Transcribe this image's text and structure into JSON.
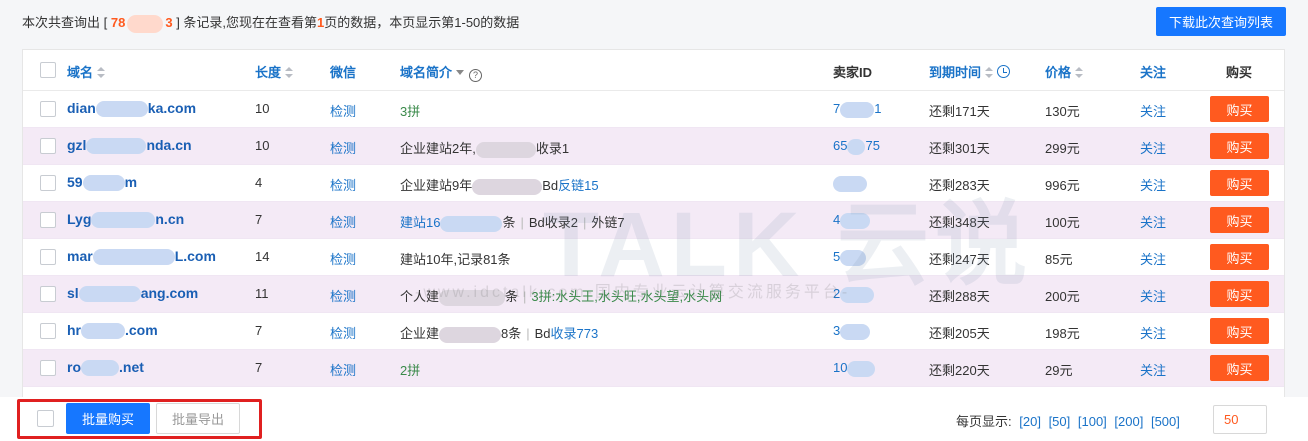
{
  "summary": {
    "prefix": "本次共查询出 [",
    "count": "78",
    "count_tail": "3",
    "middle": "] 条记录,您现在在查看第",
    "page": "1",
    "suffix": "页的数据，本页显示第1-50的数据"
  },
  "download_label": "下载此次查询列表",
  "headers": {
    "domain": "域名",
    "length": "长度",
    "wechat": "微信",
    "intro": "域名简介",
    "seller": "卖家ID",
    "expiry": "到期时间",
    "price": "价格",
    "follow": "关注",
    "buy": "购买"
  },
  "rows": [
    {
      "dom_a": "dian",
      "dom_b": "ka.com",
      "length": "10",
      "check": "检测",
      "intro_a": "3拼",
      "intro_b": "",
      "intro_c": "",
      "seller_a": "7",
      "seller_b": "1",
      "expiry": "还剩171天",
      "price": "130元",
      "follow": "关注",
      "buy": "购买"
    },
    {
      "dom_a": "gzl",
      "dom_b": "nda.cn",
      "length": "10",
      "check": "检测",
      "intro_a": "企业建站2年,",
      "intro_b": "收录1",
      "intro_c": "",
      "seller_a": "65",
      "seller_b": "75",
      "expiry": "还剩301天",
      "price": "299元",
      "follow": "关注",
      "buy": "购买"
    },
    {
      "dom_a": "59",
      "dom_b": "m",
      "length": "4",
      "check": "检测",
      "intro_a": "企业建站9年",
      "intro_b": "Bd",
      "intro_c": "反链15",
      "seller_a": "",
      "seller_b": "",
      "expiry": "还剩283天",
      "price": "996元",
      "follow": "关注",
      "buy": "购买"
    },
    {
      "dom_a": "Lyg",
      "dom_b": "n.cn",
      "length": "7",
      "check": "检测",
      "intro_a": "建站16",
      "intro_b": "条",
      "intro_c": "Bd收录2",
      "intro_d": "外链7",
      "seller_a": "4",
      "seller_b": "",
      "expiry": "还剩348天",
      "price": "100元",
      "follow": "关注",
      "buy": "购买"
    },
    {
      "dom_a": "mar",
      "dom_b": "L.com",
      "length": "14",
      "check": "检测",
      "intro_a": "建站10年,记录81条",
      "intro_b": "",
      "intro_c": "",
      "seller_a": "5",
      "seller_b": "",
      "expiry": "还剩247天",
      "price": "85元",
      "follow": "关注",
      "buy": "购买"
    },
    {
      "dom_a": "sl",
      "dom_b": "ang.com",
      "length": "11",
      "check": "检测",
      "intro_a": "个人建",
      "intro_b": "条",
      "intro_c": "3拼:水头王,水头旺,水头望,水头网",
      "seller_a": "2",
      "seller_b": "",
      "expiry": "还剩288天",
      "price": "200元",
      "follow": "关注",
      "buy": "购买"
    },
    {
      "dom_a": "hr",
      "dom_b": ".com",
      "length": "7",
      "check": "检测",
      "intro_a": "企业建",
      "intro_b": "8条",
      "intro_c": "Bd收录773",
      "seller_a": "3",
      "seller_b": "",
      "expiry": "还剩205天",
      "price": "198元",
      "follow": "关注",
      "buy": "购买"
    },
    {
      "dom_a": "ro",
      "dom_b": ".net",
      "length": "7",
      "check": "检测",
      "intro_a": "2拼",
      "intro_b": "",
      "intro_c": "",
      "seller_a": "10",
      "seller_b": "",
      "expiry": "还剩220天",
      "price": "29元",
      "follow": "关注",
      "buy": "购买"
    }
  ],
  "watermark": {
    "big": "TALK 云说",
    "small": "-www.idctalk.com-国内专业云计算交流服务平台-"
  },
  "footer": {
    "bulk_buy": "批量购买",
    "bulk_export": "批量导出",
    "perpage_label": "每页显示:",
    "opt_20": "[20]",
    "opt_50": "[50]",
    "opt_100": "[100]",
    "opt_200": "[200]",
    "opt_500": "[500]",
    "perpage_value": "50"
  }
}
